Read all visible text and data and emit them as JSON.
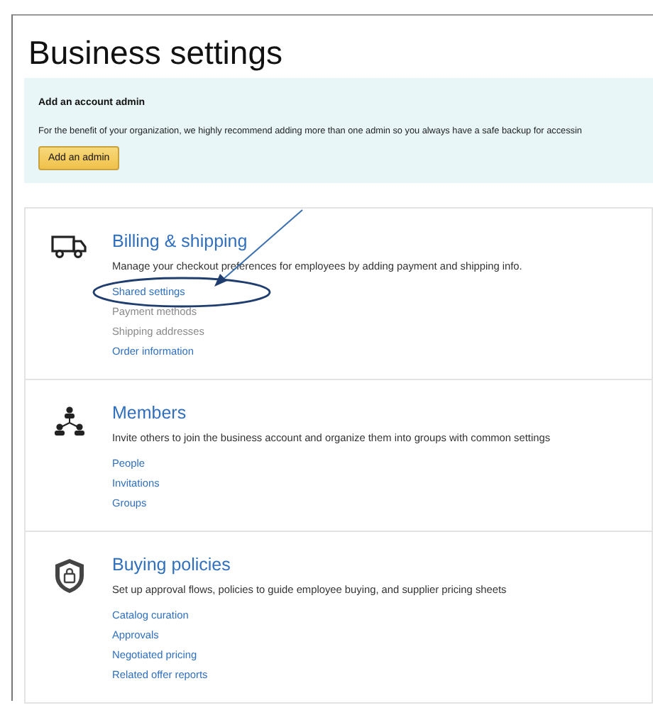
{
  "page": {
    "title": "Business settings"
  },
  "banner": {
    "heading": "Add an account admin",
    "text": "For the benefit of your organization, we highly recommend adding more than one admin so you always have a safe backup for accessin",
    "button": "Add an admin"
  },
  "sections": [
    {
      "kind": "truck",
      "title": "Billing & shipping",
      "description": "Manage your checkout preferences for employees by adding payment and shipping info.",
      "links": [
        {
          "label": "Shared settings",
          "disabled": false,
          "circled": true
        },
        {
          "label": "Payment methods",
          "disabled": true,
          "circled": false
        },
        {
          "label": "Shipping addresses",
          "disabled": true,
          "circled": false
        },
        {
          "label": "Order information",
          "disabled": false,
          "circled": false
        }
      ]
    },
    {
      "kind": "people",
      "title": "Members",
      "description": "Invite others to join the business account and organize them into groups with common settings",
      "links": [
        {
          "label": "People",
          "disabled": false,
          "circled": false
        },
        {
          "label": "Invitations",
          "disabled": false,
          "circled": false
        },
        {
          "label": "Groups",
          "disabled": false,
          "circled": false
        }
      ]
    },
    {
      "kind": "shield",
      "title": "Buying policies",
      "description": "Set up approval flows, policies to guide employee buying, and supplier pricing sheets",
      "links": [
        {
          "label": "Catalog curation",
          "disabled": false,
          "circled": false
        },
        {
          "label": "Approvals",
          "disabled": false,
          "circled": false
        },
        {
          "label": "Negotiated pricing",
          "disabled": false,
          "circled": false
        },
        {
          "label": "Related offer reports",
          "disabled": false,
          "circled": false
        }
      ]
    }
  ]
}
